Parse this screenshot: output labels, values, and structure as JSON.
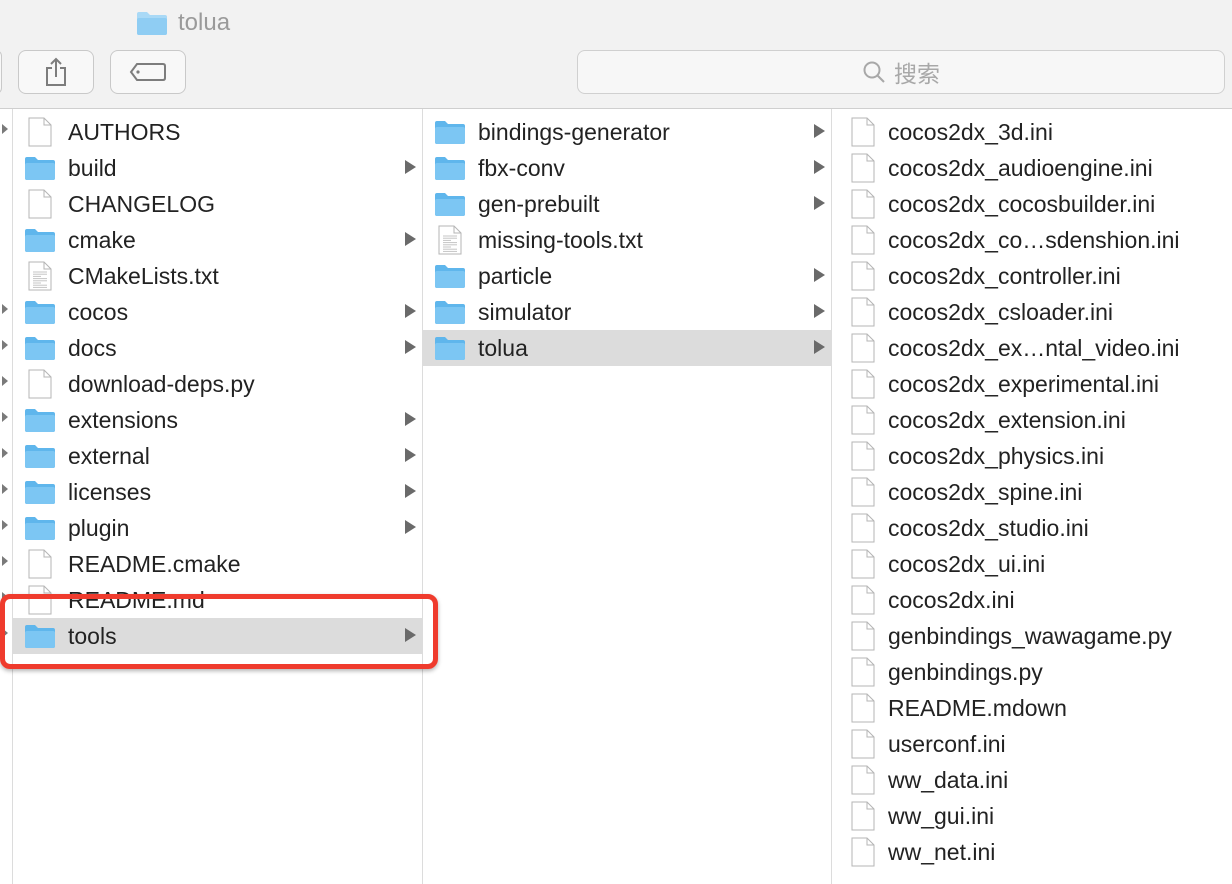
{
  "window": {
    "title": "tolua"
  },
  "toolbar": {
    "search_placeholder": "搜索"
  },
  "columns": [
    {
      "items": [
        {
          "name": "AUTHORS",
          "kind": "file",
          "has_children": false,
          "selected": false
        },
        {
          "name": "build",
          "kind": "folder",
          "has_children": true,
          "selected": false
        },
        {
          "name": "CHANGELOG",
          "kind": "file",
          "has_children": false,
          "selected": false
        },
        {
          "name": "cmake",
          "kind": "folder",
          "has_children": true,
          "selected": false
        },
        {
          "name": "CMakeLists.txt",
          "kind": "text",
          "has_children": false,
          "selected": false
        },
        {
          "name": "cocos",
          "kind": "folder",
          "has_children": true,
          "selected": false
        },
        {
          "name": "docs",
          "kind": "folder",
          "has_children": true,
          "selected": false
        },
        {
          "name": "download-deps.py",
          "kind": "file",
          "has_children": false,
          "selected": false
        },
        {
          "name": "extensions",
          "kind": "folder",
          "has_children": true,
          "selected": false
        },
        {
          "name": "external",
          "kind": "folder",
          "has_children": true,
          "selected": false
        },
        {
          "name": "licenses",
          "kind": "folder",
          "has_children": true,
          "selected": false
        },
        {
          "name": "plugin",
          "kind": "folder",
          "has_children": true,
          "selected": false
        },
        {
          "name": "README.cmake",
          "kind": "file",
          "has_children": false,
          "selected": false
        },
        {
          "name": "README.md",
          "kind": "file",
          "has_children": false,
          "selected": false
        },
        {
          "name": "tools",
          "kind": "folder",
          "has_children": true,
          "selected": true
        }
      ]
    },
    {
      "items": [
        {
          "name": "bindings-generator",
          "kind": "folder",
          "has_children": true,
          "selected": false
        },
        {
          "name": "fbx-conv",
          "kind": "folder",
          "has_children": true,
          "selected": false
        },
        {
          "name": "gen-prebuilt",
          "kind": "folder",
          "has_children": true,
          "selected": false
        },
        {
          "name": "missing-tools.txt",
          "kind": "text",
          "has_children": false,
          "selected": false
        },
        {
          "name": "particle",
          "kind": "folder",
          "has_children": true,
          "selected": false
        },
        {
          "name": "simulator",
          "kind": "folder",
          "has_children": true,
          "selected": false
        },
        {
          "name": "tolua",
          "kind": "folder",
          "has_children": true,
          "selected": true
        }
      ]
    },
    {
      "items": [
        {
          "name": "cocos2dx_3d.ini",
          "kind": "file",
          "has_children": false,
          "selected": false
        },
        {
          "name": "cocos2dx_audioengine.ini",
          "kind": "file",
          "has_children": false,
          "selected": false
        },
        {
          "name": "cocos2dx_cocosbuilder.ini",
          "kind": "file",
          "has_children": false,
          "selected": false
        },
        {
          "name": "cocos2dx_co…sdenshion.ini",
          "kind": "file",
          "has_children": false,
          "selected": false
        },
        {
          "name": "cocos2dx_controller.ini",
          "kind": "file",
          "has_children": false,
          "selected": false
        },
        {
          "name": "cocos2dx_csloader.ini",
          "kind": "file",
          "has_children": false,
          "selected": false
        },
        {
          "name": "cocos2dx_ex…ntal_video.ini",
          "kind": "file",
          "has_children": false,
          "selected": false
        },
        {
          "name": "cocos2dx_experimental.ini",
          "kind": "file",
          "has_children": false,
          "selected": false
        },
        {
          "name": "cocos2dx_extension.ini",
          "kind": "file",
          "has_children": false,
          "selected": false
        },
        {
          "name": "cocos2dx_physics.ini",
          "kind": "file",
          "has_children": false,
          "selected": false
        },
        {
          "name": "cocos2dx_spine.ini",
          "kind": "file",
          "has_children": false,
          "selected": false
        },
        {
          "name": "cocos2dx_studio.ini",
          "kind": "file",
          "has_children": false,
          "selected": false
        },
        {
          "name": "cocos2dx_ui.ini",
          "kind": "file",
          "has_children": false,
          "selected": false
        },
        {
          "name": "cocos2dx.ini",
          "kind": "file",
          "has_children": false,
          "selected": false
        },
        {
          "name": "genbindings_wawagame.py",
          "kind": "file",
          "has_children": false,
          "selected": false
        },
        {
          "name": "genbindings.py",
          "kind": "file",
          "has_children": false,
          "selected": false
        },
        {
          "name": "README.mdown",
          "kind": "file",
          "has_children": false,
          "selected": false
        },
        {
          "name": "userconf.ini",
          "kind": "file",
          "has_children": false,
          "selected": false
        },
        {
          "name": "ww_data.ini",
          "kind": "file",
          "has_children": false,
          "selected": false
        },
        {
          "name": "ww_gui.ini",
          "kind": "file",
          "has_children": false,
          "selected": false
        },
        {
          "name": "ww_net.ini",
          "kind": "file",
          "has_children": false,
          "selected": false
        }
      ]
    }
  ],
  "colors": {
    "folder": "#7cc6f3",
    "selection": "#dcdcdc",
    "highlight": "#ef3b2d"
  }
}
